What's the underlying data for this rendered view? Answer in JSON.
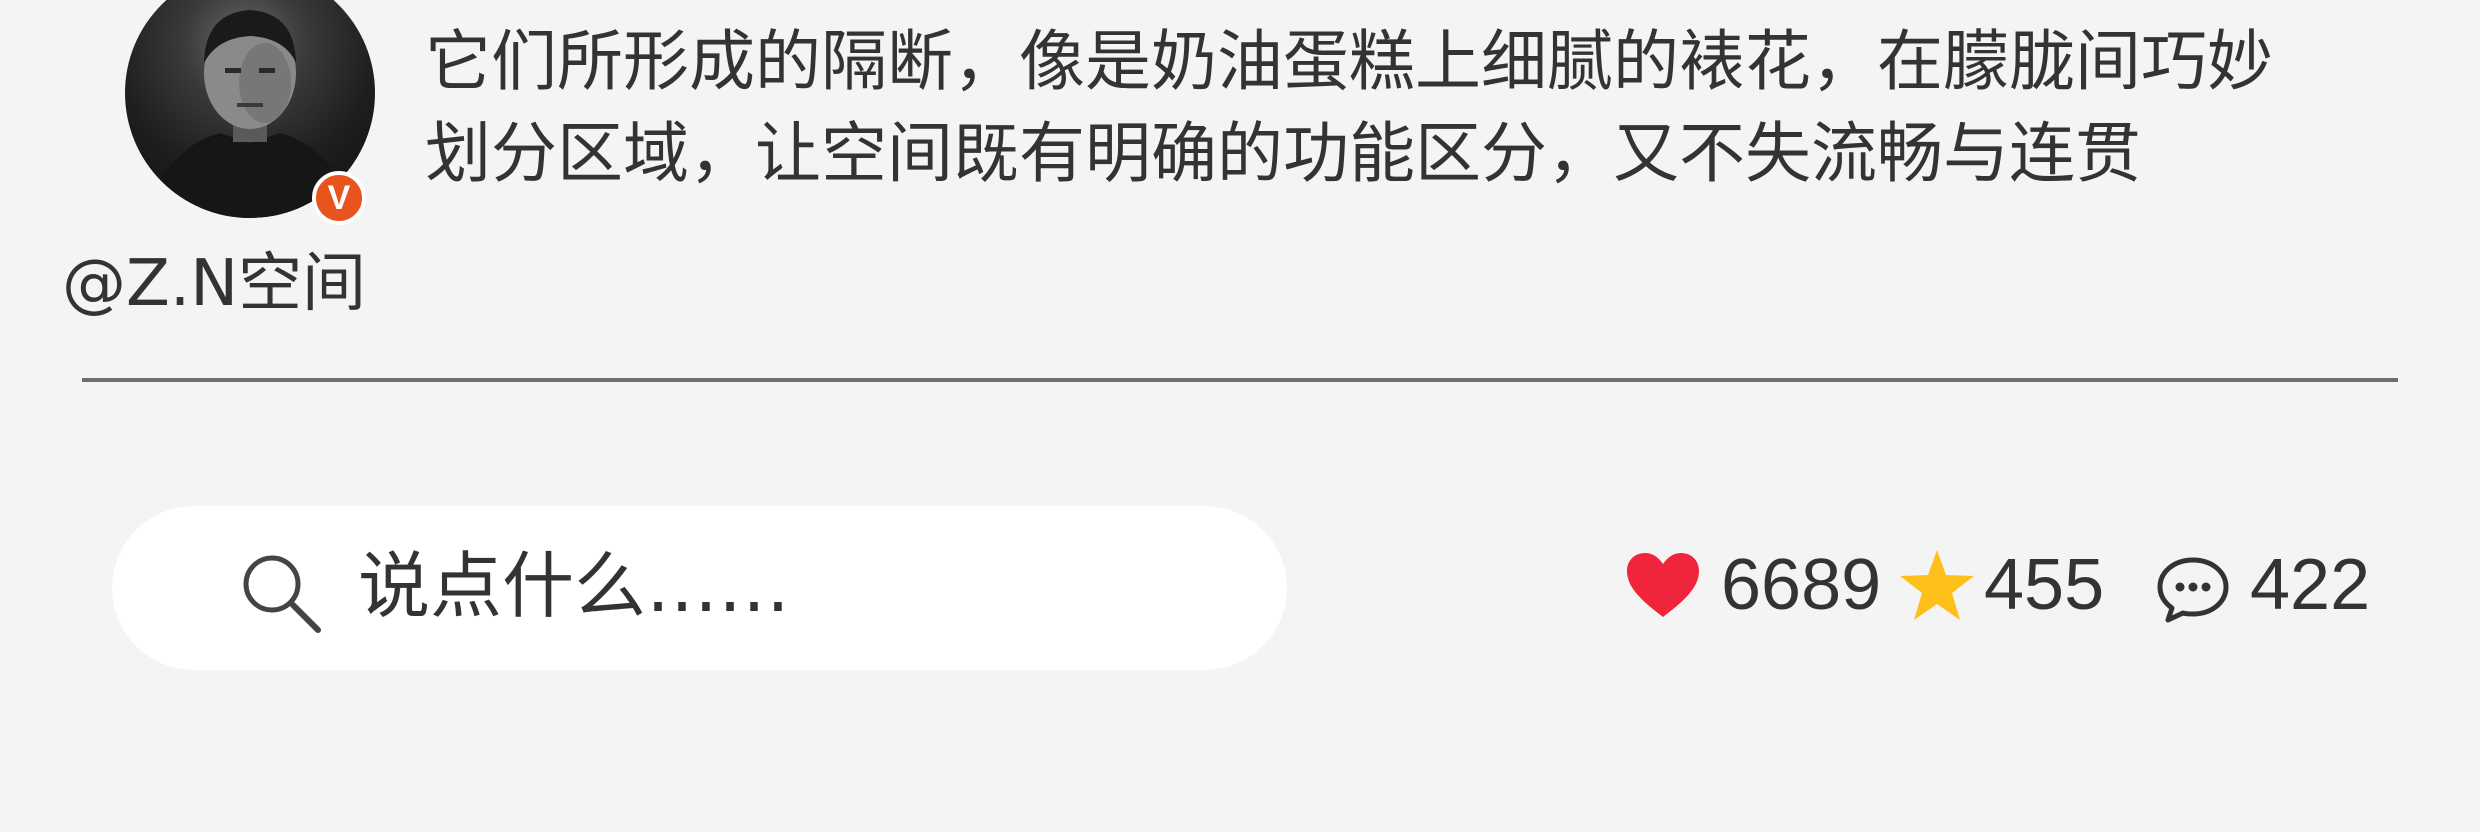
{
  "author": {
    "username": "@Z.N空间",
    "verified_badge": "V",
    "badge_color": "#e8541e"
  },
  "comment": {
    "lines": [
      "它们所形成的隔断，像是奶油蛋糕上细腻的裱花，在朦胧间巧妙",
      "划分区域，让空间既有明确的功能区分，又不失流畅与连贯"
    ]
  },
  "search": {
    "icon": "search-icon",
    "placeholder": "说点什么……"
  },
  "stats": {
    "likes": {
      "icon": "heart-icon",
      "value": "6689",
      "color": "#f0243a"
    },
    "favorites": {
      "icon": "star-icon",
      "value": "455",
      "color": "#ffbf1a"
    },
    "comments": {
      "icon": "comment-bubble-icon",
      "value": "422"
    }
  }
}
